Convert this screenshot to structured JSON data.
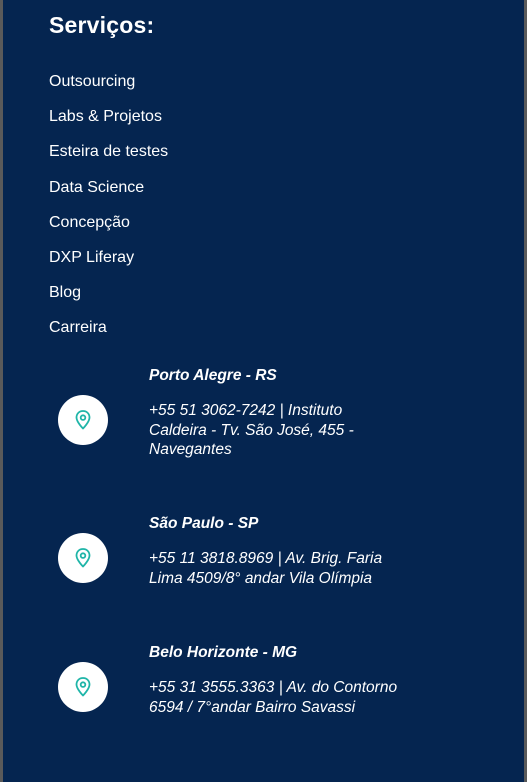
{
  "services": {
    "title": "Serviços:",
    "items": [
      {
        "label": "Outsourcing"
      },
      {
        "label": "Labs & Projetos"
      },
      {
        "label": "Esteira de testes"
      },
      {
        "label": "Data Science"
      },
      {
        "label": "Concepção"
      },
      {
        "label": "DXP Liferay"
      },
      {
        "label": "Blog"
      },
      {
        "label": "Carreira"
      }
    ]
  },
  "locations": [
    {
      "city": "Porto Alegre - RS",
      "address": "+55 51 3062-7242 | Instituto Caldeira - Tv. São José, 455 - Navegantes",
      "icon": "map-pin-icon"
    },
    {
      "city": "São Paulo - SP",
      "address": "+55 11 3818.8969 | Av. Brig. Faria Lima 4509/8° andar Vila Olímpia",
      "icon": "map-pin-icon"
    },
    {
      "city": "Belo Horizonte - MG",
      "address": "+55 31 3555.3363 | Av. do Contorno 6594 / 7°andar Bairro Savassi",
      "icon": "map-pin-icon"
    }
  ],
  "colors": {
    "background": "#052550",
    "text": "#ffffff",
    "icon_accent": "#1fb5a8",
    "icon_circle": "#ffffff"
  }
}
